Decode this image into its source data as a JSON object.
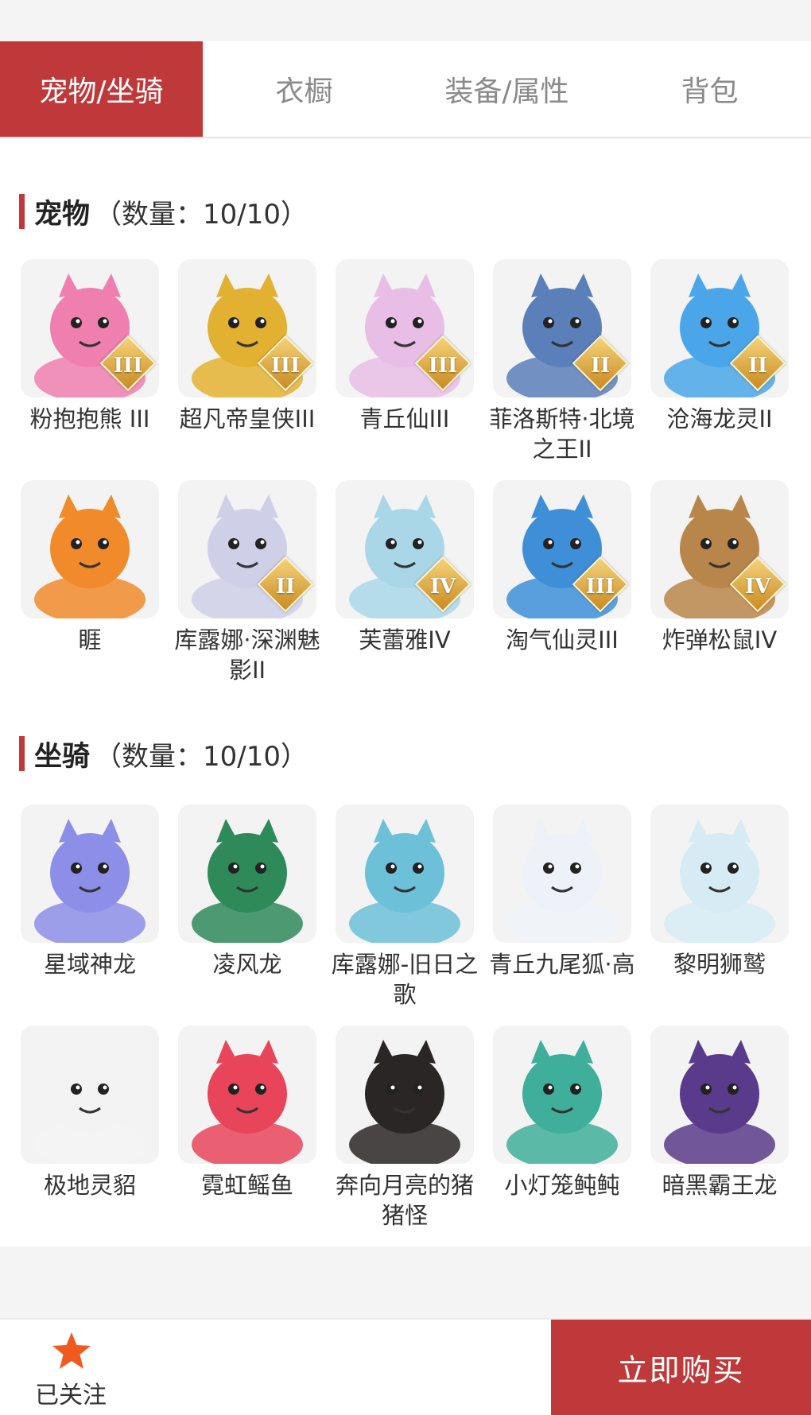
{
  "tabs": [
    {
      "label": "宠物/坐骑",
      "active": true
    },
    {
      "label": "衣橱",
      "active": false
    },
    {
      "label": "装备/属性",
      "active": false
    },
    {
      "label": "背包",
      "active": false
    }
  ],
  "pets": {
    "title": "宠物",
    "count": "（数量：10/10）",
    "items": [
      {
        "name": "粉抱抱熊 III",
        "badge": "III",
        "icon": "pink-bear-icon",
        "color": "#ef7fae"
      },
      {
        "name": "超凡帝皇侠III",
        "badge": "III",
        "icon": "gold-armor-hero-icon",
        "color": "#e3b131"
      },
      {
        "name": "青丘仙III",
        "badge": "III",
        "icon": "fox-fairy-icon",
        "color": "#e8bde6"
      },
      {
        "name": "菲洛斯特·北境之王II",
        "badge": "II",
        "icon": "frost-king-icon",
        "color": "#5b7fb8"
      },
      {
        "name": "沧海龙灵II",
        "badge": "II",
        "icon": "sea-dragon-spirit-icon",
        "color": "#4aa6e8"
      },
      {
        "name": "睚",
        "badge": "",
        "icon": "fire-dragon-icon",
        "color": "#f08a2a"
      },
      {
        "name": "库露娜·深渊魅影II",
        "badge": "II",
        "icon": "abyss-phantom-icon",
        "color": "#cfcfe8"
      },
      {
        "name": "芙蕾雅IV",
        "badge": "IV",
        "icon": "valkyrie-icon",
        "color": "#a9d7e8"
      },
      {
        "name": "淘气仙灵III",
        "badge": "III",
        "icon": "blue-puppy-icon",
        "color": "#3e8fd8"
      },
      {
        "name": "炸弹松鼠IV",
        "badge": "IV",
        "icon": "bomb-squirrel-icon",
        "color": "#b8864a"
      }
    ]
  },
  "mounts": {
    "title": "坐骑",
    "count": "（数量：10/10）",
    "items": [
      {
        "name": "星域神龙",
        "icon": "star-dragon-icon",
        "color": "#8c8ee8"
      },
      {
        "name": "凌风龙",
        "icon": "wind-dragon-icon",
        "color": "#2f8a5a"
      },
      {
        "name": "库露娜-旧日之歌",
        "icon": "old-song-girl-icon",
        "color": "#6cc0d8"
      },
      {
        "name": "青丘九尾狐·高",
        "icon": "nine-tail-fox-icon",
        "color": "#eef2f8"
      },
      {
        "name": "黎明狮鹫",
        "icon": "griffin-icon",
        "color": "#d6ebf4"
      },
      {
        "name": "极地灵貂",
        "icon": "polar-mink-icon",
        "color": "#f3f3f3"
      },
      {
        "name": "霓虹鳐鱼",
        "icon": "neon-ray-icon",
        "color": "#e8455a"
      },
      {
        "name": "奔向月亮的猪猪怪",
        "icon": "moon-pig-icon",
        "color": "#2b2626"
      },
      {
        "name": "小灯笼鲀鲀",
        "icon": "lantern-puffer-icon",
        "color": "#3fae9a"
      },
      {
        "name": "暗黑霸王龙",
        "icon": "dark-trex-icon",
        "color": "#5a3a8a"
      }
    ]
  },
  "bottom": {
    "follow_label": "已关注",
    "buy_label": "立即购买"
  },
  "colors": {
    "accent": "#c0393a",
    "star": "#f05a1e"
  }
}
